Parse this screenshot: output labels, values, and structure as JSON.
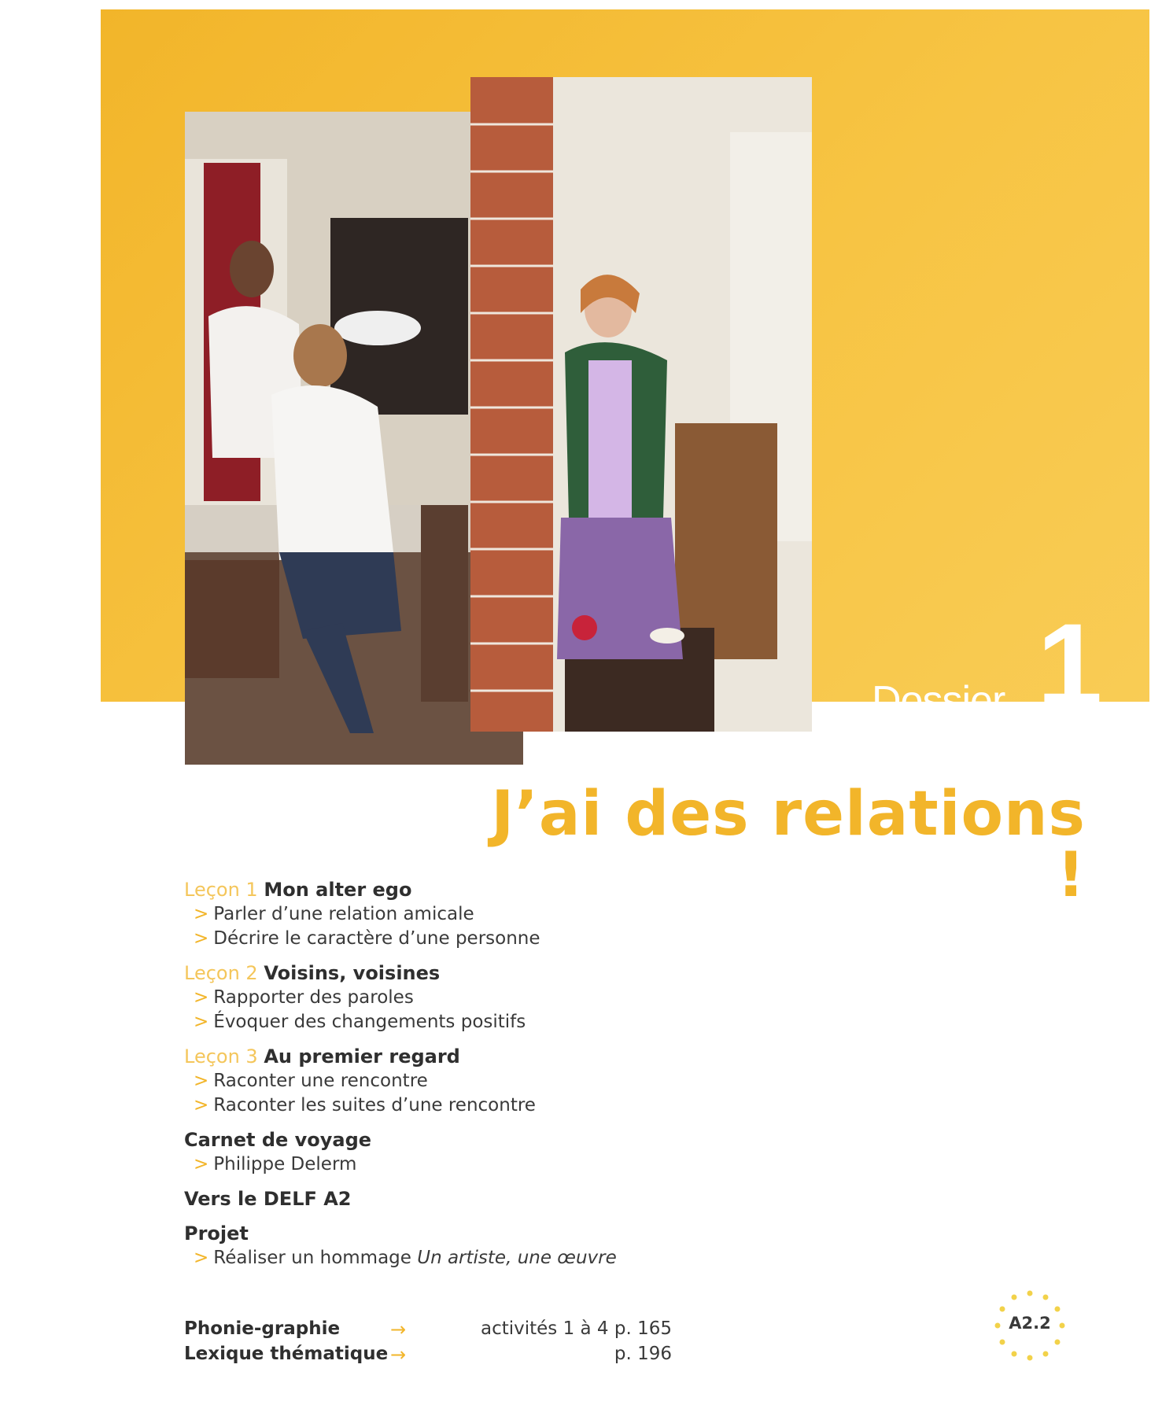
{
  "header": {
    "dossier_label": "Dossier",
    "dossier_number": "1",
    "title": "J’ai des relations !"
  },
  "colors": {
    "accent": "#f2b52a",
    "lesson": "#f4c65b",
    "text": "#3a3a3a"
  },
  "lessons": [
    {
      "label": "Leçon 1",
      "title": "Mon alter ego",
      "items": [
        "Parler d’une relation amicale",
        "Décrire le caractère d’une personne"
      ]
    },
    {
      "label": "Leçon 2",
      "title": "Voisins, voisines",
      "items": [
        "Rapporter des paroles",
        "Évoquer des changements positifs"
      ]
    },
    {
      "label": "Leçon 3",
      "title": "Au premier regard",
      "items": [
        "Raconter une rencontre",
        "Raconter les suites d’une rencontre"
      ]
    }
  ],
  "carnet": {
    "title": "Carnet de voyage",
    "item": "Philippe Delerm"
  },
  "delf": {
    "title": "Vers le DELF A2"
  },
  "projet": {
    "title": "Projet",
    "item_prefix": "Réaliser un hommage ",
    "item_italic": "Un artiste, une œuvre"
  },
  "arrow_glyph": ">",
  "references": [
    {
      "label": "Phonie-graphie",
      "arrow": "→",
      "value": "activités 1 à 4 p. 165"
    },
    {
      "label": "Lexique thématique",
      "arrow": "→",
      "value": "p. 196"
    }
  ],
  "level_badge": "A2.2"
}
